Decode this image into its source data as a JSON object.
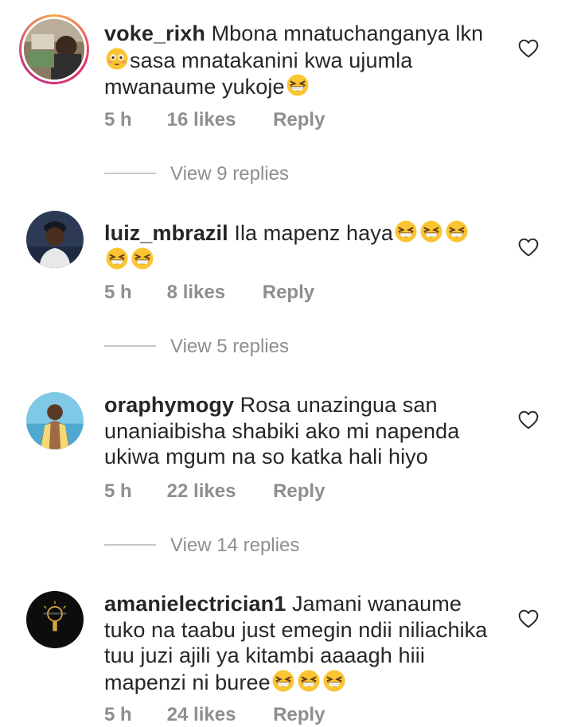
{
  "comments": [
    {
      "username": "voke_rixh",
      "text_parts": [
        "Mbona mnatuchanganya lkn",
        "sasa mnatakanini kwa ujumla mwanaume yukoje"
      ],
      "time": "5 h",
      "likes": "16 likes",
      "reply": "Reply",
      "view_replies": "View 9 replies"
    },
    {
      "username": "luiz_mbrazil",
      "text": "Ila mapenz haya",
      "time": "5 h",
      "likes": "8 likes",
      "reply": "Reply",
      "view_replies": "View 5 replies"
    },
    {
      "username": "oraphymogy",
      "text": "Rosa unazingua san unaniaibisha shabiki ako mi napenda ukiwa mgum na so katka hali hiyo",
      "time": "5 h",
      "likes": "22 likes",
      "reply": "Reply",
      "view_replies": "View 14 replies"
    },
    {
      "username": "amanielectrician1",
      "text": "Jamani wanaume tuko na taabu just emegin ndii niliachika tuu juzi ajili ya kitambi aaaagh hiii mapenzi ni buree",
      "time": "5 h",
      "likes": "24 likes",
      "reply": "Reply"
    }
  ],
  "icons": {
    "like": "heart-outline-icon",
    "emoji_grin": "grinning-squinting-face-emoji",
    "emoji_flushed": "flushed-face-emoji"
  },
  "colors": {
    "text": "#262626",
    "meta": "#8e8e8e",
    "emoji": "#fbc531"
  }
}
